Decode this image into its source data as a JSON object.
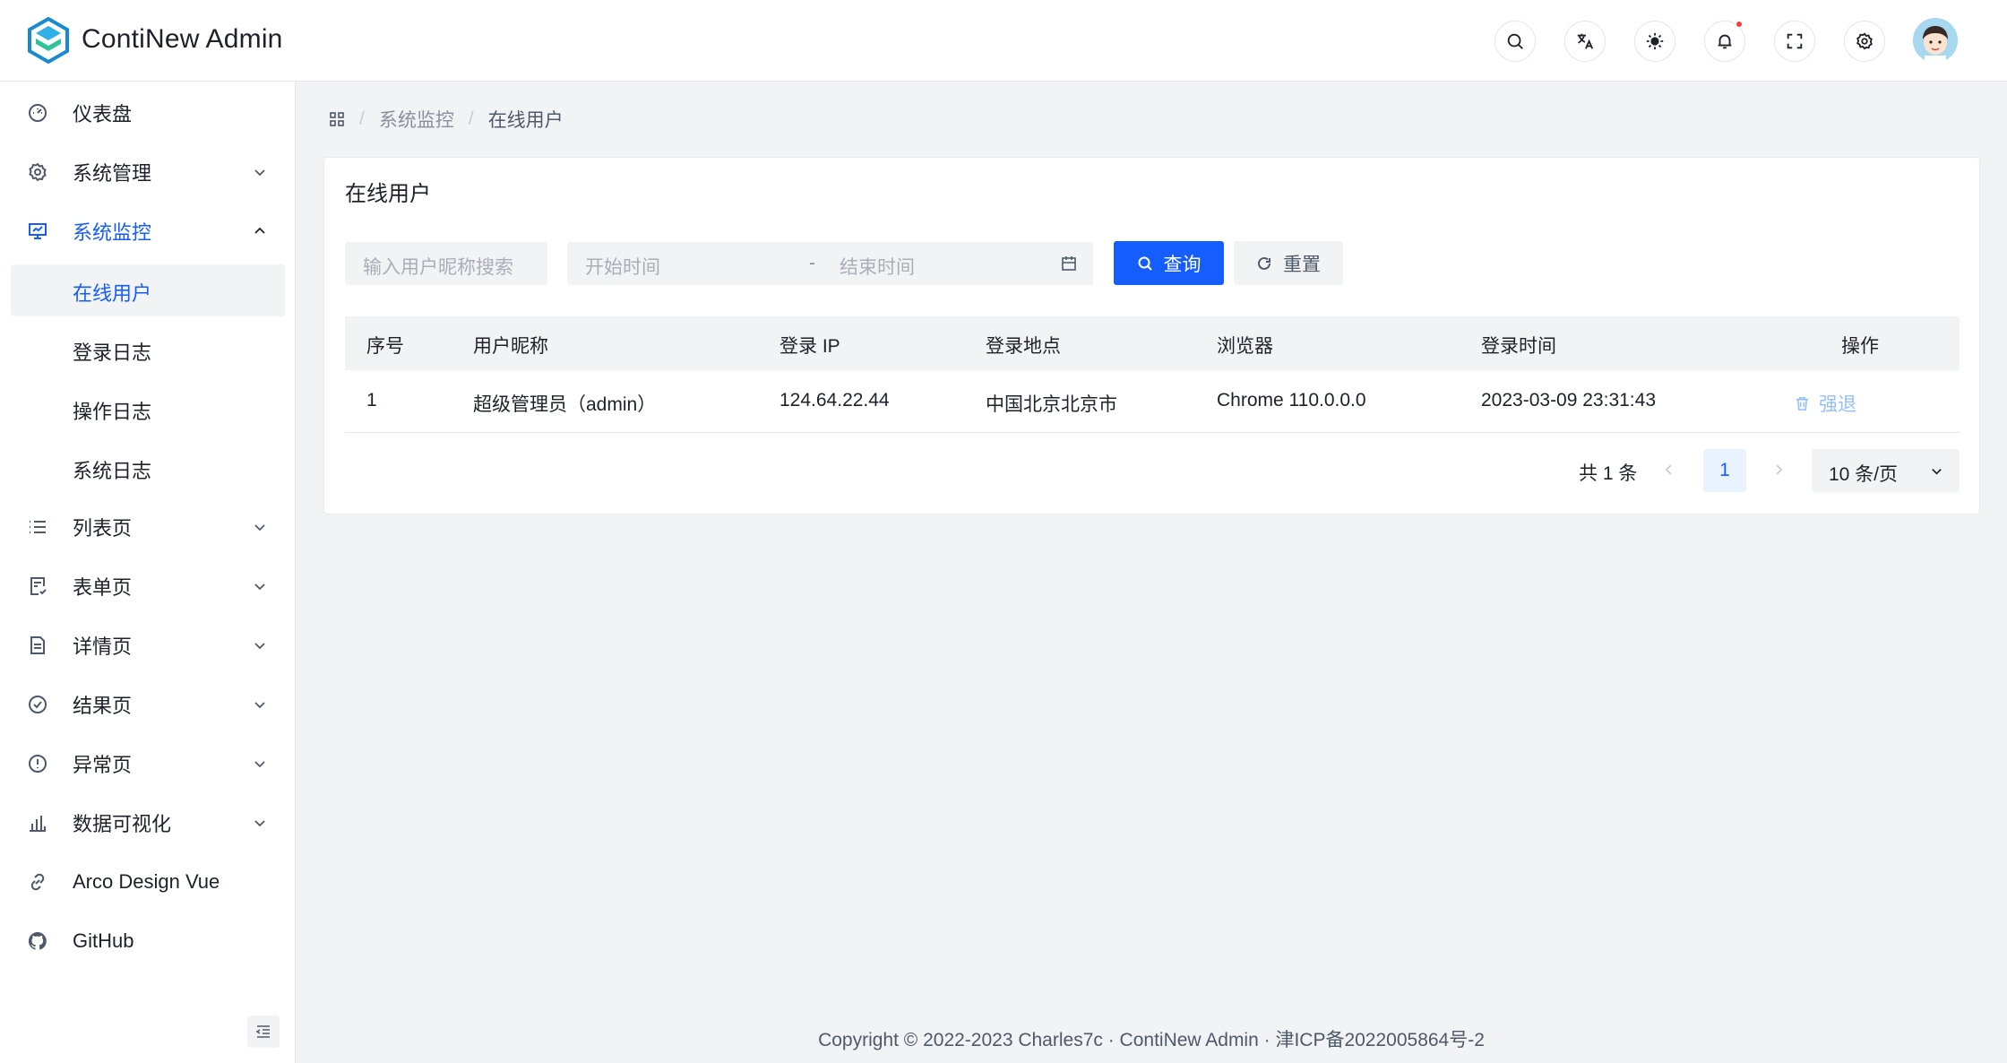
{
  "header": {
    "title": "ContiNew Admin",
    "icons": [
      "search-icon",
      "translate-icon",
      "theme-icon",
      "bell-icon",
      "fullscreen-icon",
      "settings-icon"
    ]
  },
  "sidebar": {
    "items": [
      {
        "label": "仪表盘",
        "icon": "dashboard-icon"
      },
      {
        "label": "系统管理",
        "icon": "gear-icon"
      },
      {
        "label": "系统监控",
        "icon": "monitor-icon"
      },
      {
        "label": "列表页",
        "icon": "list-icon"
      },
      {
        "label": "表单页",
        "icon": "form-icon"
      },
      {
        "label": "详情页",
        "icon": "file-icon"
      },
      {
        "label": "结果页",
        "icon": "check-circle-icon"
      },
      {
        "label": "异常页",
        "icon": "exclamation-circle-icon"
      },
      {
        "label": "数据可视化",
        "icon": "bar-chart-icon"
      },
      {
        "label": "Arco Design Vue",
        "icon": "link-icon"
      },
      {
        "label": "GitHub",
        "icon": "github-icon"
      }
    ],
    "monitor_sub": [
      "在线用户",
      "登录日志",
      "操作日志",
      "系统日志"
    ]
  },
  "breadcrumb": {
    "level1": "系统监控",
    "level2": "在线用户"
  },
  "card": {
    "title": "在线用户",
    "search_placeholder": "输入用户昵称搜索",
    "start_placeholder": "开始时间",
    "range_sep": "-",
    "end_placeholder": "结束时间",
    "query_label": "查询",
    "reset_label": "重置"
  },
  "table": {
    "columns": [
      "序号",
      "用户昵称",
      "登录 IP",
      "登录地点",
      "浏览器",
      "登录时间",
      "操作"
    ],
    "rows": [
      {
        "index": "1",
        "nickname": "超级管理员（admin）",
        "ip": "124.64.22.44",
        "location": "中国北京北京市",
        "browser": "Chrome 110.0.0.0",
        "time": "2023-03-09 23:31:43",
        "action": "强退"
      }
    ]
  },
  "pagination": {
    "total": "共 1 条",
    "current": "1",
    "page_size": "10 条/页"
  },
  "footer": "Copyright © 2022-2023 Charles7c · ContiNew Admin · 津ICP备2022005864号-2",
  "colors": {
    "primary": "#165dff",
    "danger_light": "#94bfff",
    "background": "#f2f3f5"
  }
}
